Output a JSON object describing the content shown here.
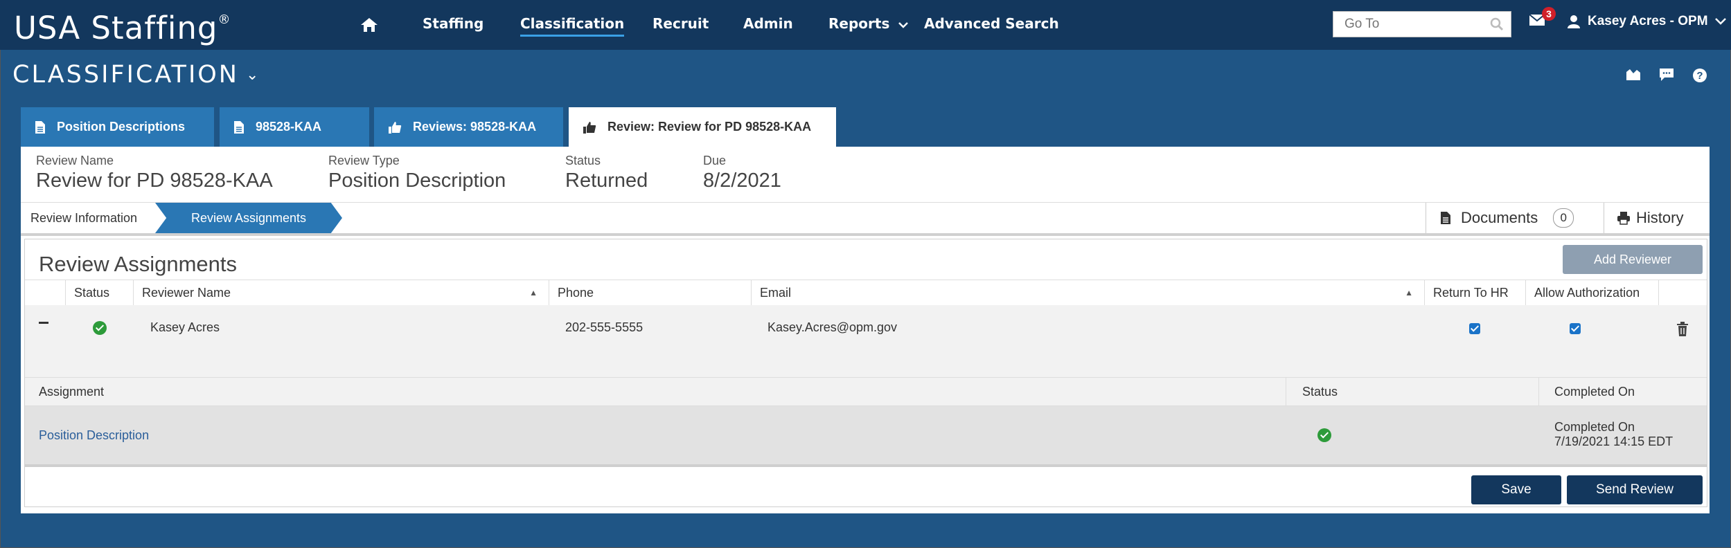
{
  "app": {
    "logo": "USA Staffing",
    "logo_mark": "®"
  },
  "nav": {
    "items": [
      "Staffing",
      "Classification",
      "Recruit",
      "Admin",
      "Reports",
      "Advanced Search"
    ],
    "active": "Classification"
  },
  "search": {
    "placeholder": "Go To"
  },
  "notifications": {
    "count": "3"
  },
  "user": {
    "name": "Kasey Acres - OPM"
  },
  "module": {
    "title": "CLASSIFICATION"
  },
  "tabs": [
    {
      "label": "Position Descriptions",
      "icon": "document-icon"
    },
    {
      "label": "98528-KAA",
      "icon": "document-icon"
    },
    {
      "label": "Reviews: 98528-KAA",
      "icon": "thumbs-up-icon"
    },
    {
      "label": "Review: Review for PD 98528-KAA",
      "icon": "thumbs-up-icon",
      "active": true
    }
  ],
  "summary": {
    "review_name_label": "Review Name",
    "review_name": "Review for PD 98528-KAA",
    "review_type_label": "Review Type",
    "review_type": "Position Description",
    "status_label": "Status",
    "status": "Returned",
    "due_label": "Due",
    "due": "8/2/2021"
  },
  "subnav": {
    "review_information": "Review Information",
    "review_assignments": "Review Assignments",
    "documents_label": "Documents",
    "documents_count": "0",
    "history_label": "History"
  },
  "section": {
    "title": "Review Assignments",
    "add_reviewer": "Add Reviewer",
    "columns": {
      "status": "Status",
      "reviewer_name": "Reviewer Name",
      "phone": "Phone",
      "email": "Email",
      "return_to_hr": "Return To HR",
      "allow_authorization": "Allow Authorization"
    },
    "reviewer": {
      "name": "Kasey Acres",
      "phone": "202-555-5555",
      "email": "Kasey.Acres@opm.gov",
      "return_to_hr": true,
      "allow_authorization": true
    },
    "assignment_columns": {
      "assignment": "Assignment",
      "status": "Status",
      "completed_on": "Completed On"
    },
    "assignment": {
      "name": "Position Description",
      "completed_label": "Completed On",
      "completed_on": "7/19/2021 14:15 EDT"
    }
  },
  "footer": {
    "save": "Save",
    "send_review": "Send Review"
  },
  "colors": {
    "nav_bg": "#13375d",
    "page_bg": "#1f5585",
    "tab_blue": "#2a77b4",
    "success": "#2d9b3a"
  }
}
